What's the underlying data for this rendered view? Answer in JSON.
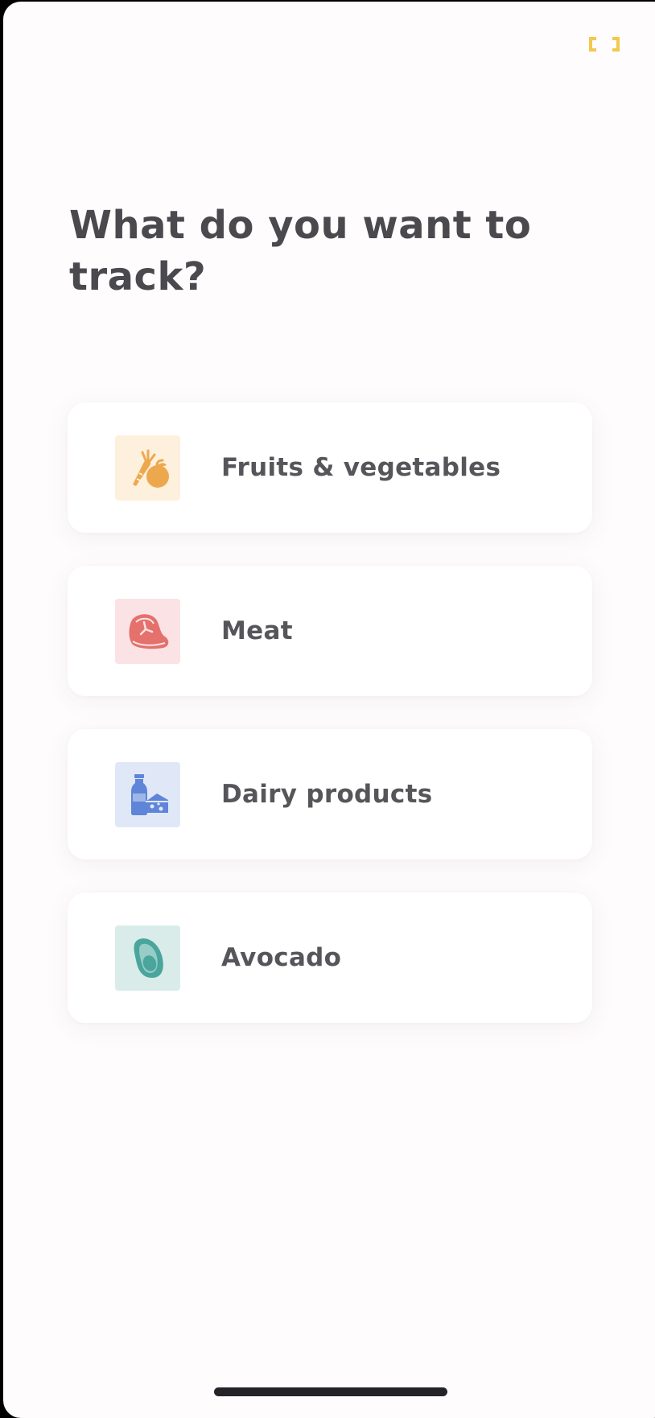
{
  "screen": {
    "title": "What do you want to track?"
  },
  "options": [
    {
      "label": "Fruits & vegetables",
      "icon": "carrot-orange-icon",
      "icon_bg": "#fdf0dc",
      "icon_color": "#eda84e"
    },
    {
      "label": "Meat",
      "icon": "steak-icon",
      "icon_bg": "#fbe2e5",
      "icon_color": "#e4716c"
    },
    {
      "label": "Dairy products",
      "icon": "milk-cheese-icon",
      "icon_bg": "#e0e8f8",
      "icon_color": "#5f85d8"
    },
    {
      "label": "Avocado",
      "icon": "avocado-icon",
      "icon_bg": "#d9ecea",
      "icon_color": "#4aa59c"
    }
  ],
  "colors": {
    "background": "#fefcfd",
    "title_text": "#4a494d",
    "label_text": "#56555a",
    "corner_mark": "#f2c94c"
  }
}
